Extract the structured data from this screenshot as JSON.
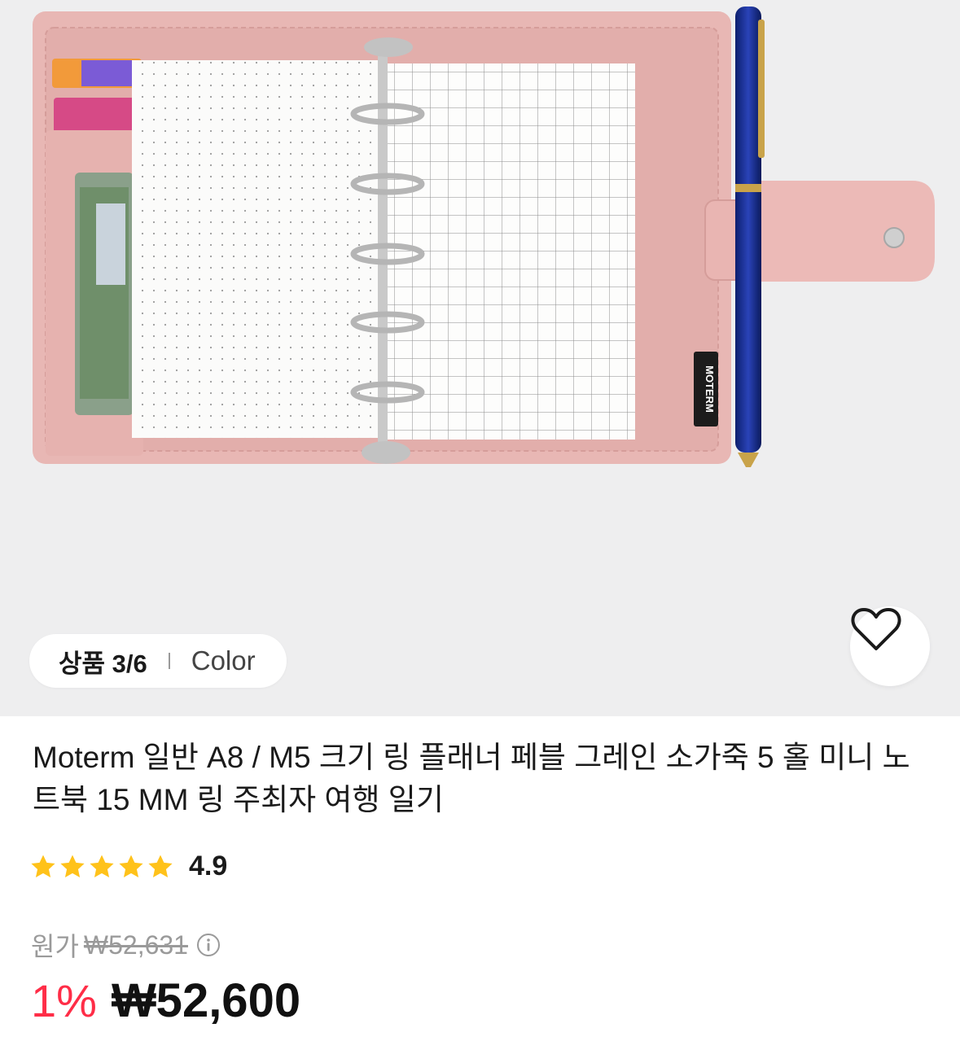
{
  "gallery": {
    "counter": "상품 3/6",
    "variant_label": "Color",
    "product_brand_label": "MOTERM"
  },
  "product": {
    "title": "Moterm 일반 A8 / M5 크기 링 플래너 페블 그레인 소가죽 5 홀 미니 노트북 15 MM 링 주최자 여행 일기",
    "rating": "4.9",
    "rating_stars": 5
  },
  "pricing": {
    "original_prefix": "원가",
    "original_price": "₩52,631",
    "discount": "1%",
    "price": "₩52,600"
  },
  "colors": {
    "accent": "#ff2d47",
    "star": "#ffc21a",
    "leather": "#e8b7b4"
  },
  "icons": {
    "wishlist": "heart-outline-icon",
    "info": "info-circle-icon",
    "rating": "star-icon"
  }
}
